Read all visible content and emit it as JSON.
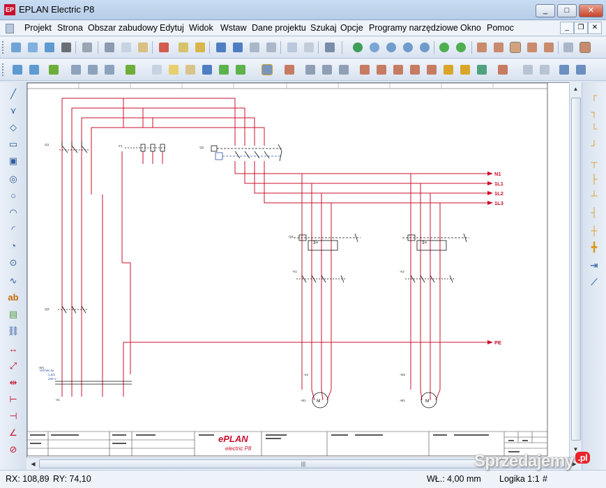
{
  "window": {
    "title": "EPLAN Electric P8",
    "icon_label": "EP",
    "min": "_",
    "max": "□",
    "close": "✕"
  },
  "menu": {
    "items": [
      "Projekt",
      "Strona",
      "Obszar zabudowy",
      "Edytuj",
      "Widok",
      "Wstaw",
      "Dane projektu",
      "Szukaj",
      "Opcje",
      "Programy narzędziowe",
      "Okno",
      "Pomoc"
    ],
    "mdi_min": "_",
    "mdi_restore": "❐",
    "mdi_close": "✕"
  },
  "schematic": {
    "net_labels": [
      "N1",
      "1L1",
      "1L2",
      "1L3",
      "PE"
    ],
    "device_tags": [
      "-Q1",
      "-F1",
      "-Q2",
      "-Q3",
      "-K1",
      "-Q4",
      "-K2",
      "-M1",
      "-M2",
      "-X1",
      "-X2",
      "-W1",
      "-W2"
    ],
    "supply_cable": [
      "H07VK 5x",
      "1,5/2",
      "230 V"
    ],
    "titleblock": {
      "logo_main": "ePLAN",
      "logo_sub": "electric P8"
    }
  },
  "scroll": {
    "grip": "|||"
  },
  "status": {
    "rx": "RX: 108,89",
    "ry": "RY: 74,10",
    "wl": "WŁ.: 4,00 mm",
    "logic": "Logika 1:1",
    "hash": "#"
  },
  "watermark": {
    "text": "Sprzedajemy",
    "suffix": ".pl"
  }
}
